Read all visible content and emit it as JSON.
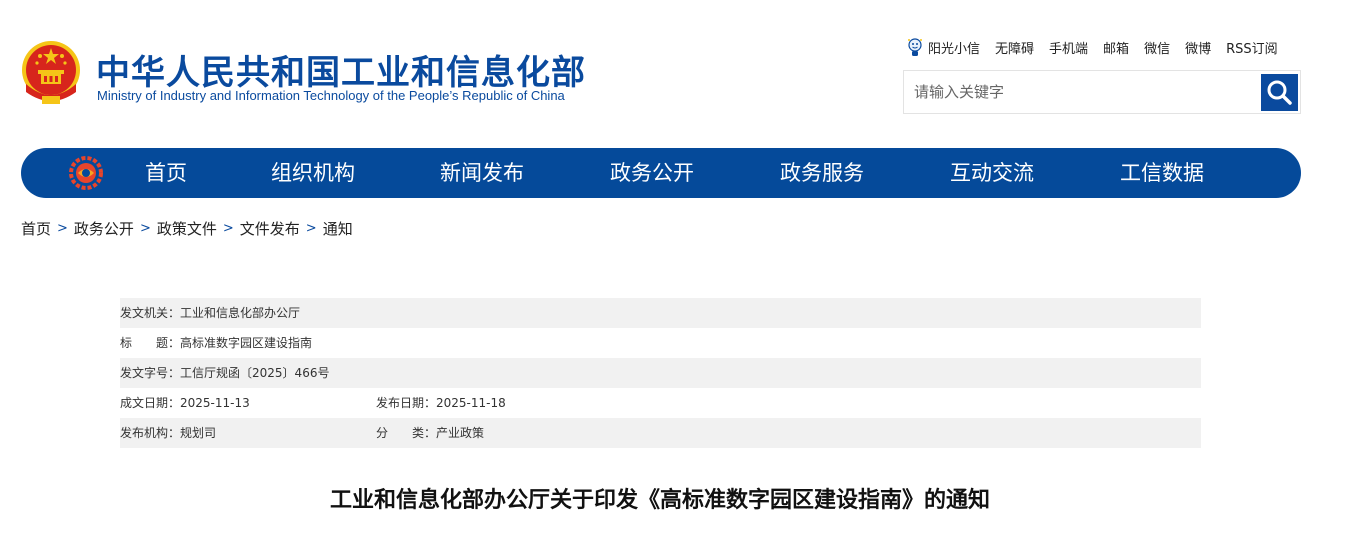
{
  "site": {
    "title_cn": "中华人民共和国工业和信息化部",
    "title_en": "Ministry of Industry and Information Technology of the People’s Republic of China"
  },
  "top_links": [
    "阳光小信",
    "无障碍",
    "手机端",
    "邮箱",
    "微信",
    "微博",
    "RSS订阅"
  ],
  "search": {
    "placeholder": "请输入关键字",
    "value": ""
  },
  "nav": [
    "首页",
    "组织机构",
    "新闻发布",
    "政务公开",
    "政务服务",
    "互动交流",
    "工信数据"
  ],
  "breadcrumb": [
    "首页",
    "政务公开",
    "政策文件",
    "文件发布",
    "通知"
  ],
  "breadcrumb_sep": ">",
  "info": {
    "issuer_label": "发文机关：",
    "issuer": "工业和信息化部办公厅",
    "title_label": "标　　题：",
    "title": "高标准数字园区建设指南",
    "number_label": "发文字号：",
    "number": "工信厅规函〔2025〕466号",
    "created_label": "成文日期：",
    "created": "2025-11-13",
    "published_label": "发布日期：",
    "published": "2025-11-18",
    "agency_label": "发布机构：",
    "agency": "规划司",
    "category_label": "分　　类：",
    "category": "产业政策"
  },
  "doc_title": "工业和信息化部办公厅关于印发《高标准数字园区建设指南》的通知",
  "colors": {
    "brand_blue": "#0a4a9e",
    "nav_blue": "#054a9a",
    "emblem_red": "#d7251c",
    "emblem_gold": "#f5c518"
  }
}
